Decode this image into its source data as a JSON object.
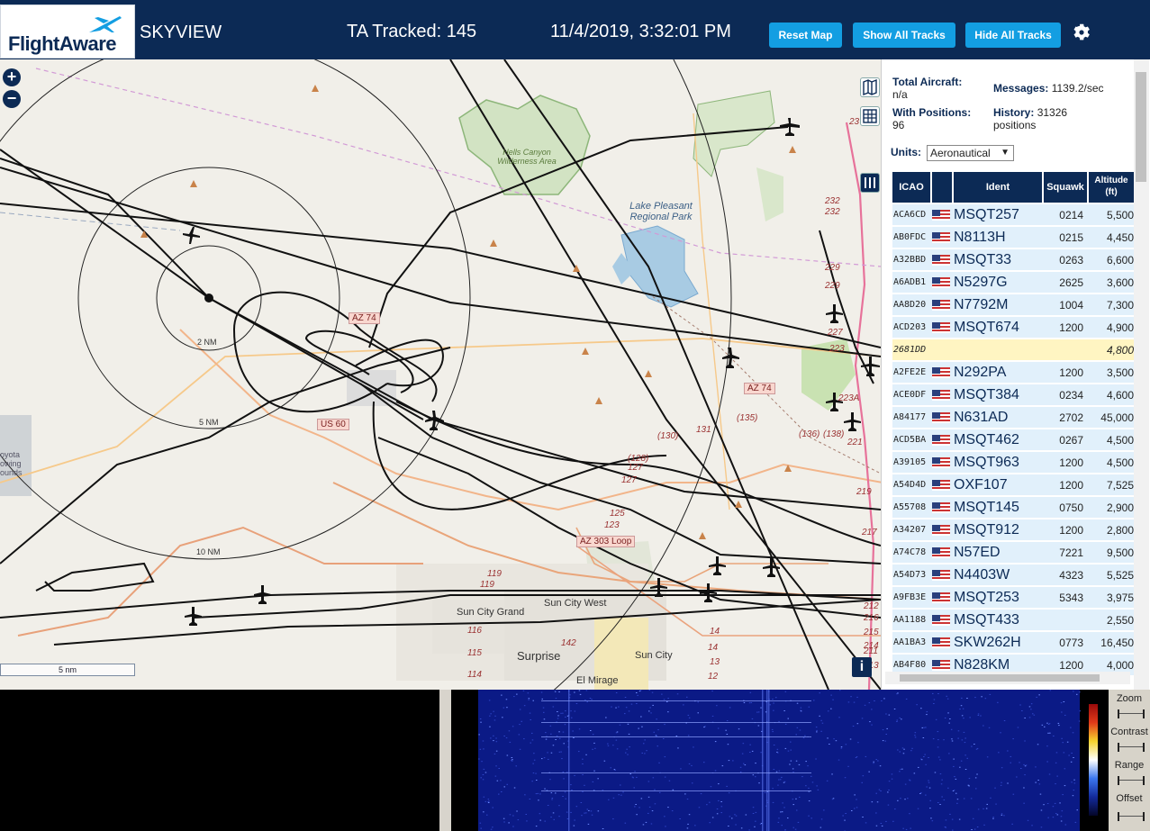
{
  "header": {
    "logo_text": "FlightAware",
    "app_name": "SKYVIEW",
    "ta_tracked": "TA Tracked: 145",
    "datetime": "11/4/2019, 3:32:01 PM",
    "buttons": {
      "reset_map": "Reset Map",
      "show_all": "Show All Tracks",
      "hide_all": "Hide All Tracks"
    },
    "settings_icon": "gear-icon"
  },
  "map": {
    "zoom_in": "+",
    "zoom_out": "−",
    "range_rings": [
      "2 NM",
      "5 NM",
      "10 NM"
    ],
    "places": {
      "hells_canyon": "Hells Canyon Wilderness Area",
      "lake_pleasant": "Lake Pleasant Regional Park",
      "sun_city_grand": "Sun City Grand",
      "sun_city_west": "Sun City West",
      "surprise": "Surprise",
      "sun_city": "Sun City",
      "el_mirage": "El Mirage",
      "coyote": "oyota owing ounds"
    },
    "road_signs": {
      "az74_west": "AZ 74",
      "az74_east": "AZ 74",
      "us60": "US 60",
      "az303": "AZ 303 Loop"
    },
    "route_numbers": [
      "232",
      "232",
      "229",
      "229",
      "227",
      "223",
      "223A",
      "221",
      "219",
      "217",
      "216",
      "215",
      "214",
      "213",
      "212",
      "211",
      "(135)",
      "(136)",
      "(138)",
      "(130)",
      "131",
      "(128)",
      "127",
      "127",
      "125",
      "123",
      "119",
      "119",
      "116",
      "115",
      "114",
      "142",
      "14",
      "14",
      "13",
      "12",
      "23"
    ],
    "scale_label": "5 nm",
    "info_button": "i"
  },
  "sidebar": {
    "total_aircraft_label": "Total Aircraft:",
    "total_aircraft_value": "n/a",
    "with_positions_label": "With Positions:",
    "with_positions_value": "96",
    "messages_label": "Messages:",
    "messages_value": "1139.2/sec",
    "history_label": "History:",
    "history_value": "31326",
    "history_unit": "positions",
    "units_label": "Units:",
    "units_value": "Aeronautical",
    "columns": [
      "ICAO",
      "",
      "Ident",
      "Squawk",
      "Altitude (ft)"
    ],
    "rows": [
      {
        "icao": "ACA6CD",
        "ident": "MSQT257",
        "squawk": "0214",
        "alt": "5,500"
      },
      {
        "icao": "AB0FDC",
        "ident": "N8113H",
        "squawk": "0215",
        "alt": "4,450"
      },
      {
        "icao": "A32BBD",
        "ident": "MSQT33",
        "squawk": "0263",
        "alt": "6,600"
      },
      {
        "icao": "A6ADB1",
        "ident": "N5297G",
        "squawk": "2625",
        "alt": "3,600"
      },
      {
        "icao": "AA8D20",
        "ident": "N7792M",
        "squawk": "1004",
        "alt": "7,300"
      },
      {
        "icao": "ACD203",
        "ident": "MSQT674",
        "squawk": "1200",
        "alt": "4,900"
      },
      {
        "icao": "2681DD",
        "ident": "",
        "squawk": "",
        "alt": "4,800",
        "selected": true
      },
      {
        "icao": "A2FE2E",
        "ident": "N292PA",
        "squawk": "1200",
        "alt": "3,500"
      },
      {
        "icao": "ACE0DF",
        "ident": "MSQT384",
        "squawk": "0234",
        "alt": "4,600"
      },
      {
        "icao": "A84177",
        "ident": "N631AD",
        "squawk": "2702",
        "alt": "45,000"
      },
      {
        "icao": "ACD5BA",
        "ident": "MSQT462",
        "squawk": "0267",
        "alt": "4,500"
      },
      {
        "icao": "A39105",
        "ident": "MSQT963",
        "squawk": "1200",
        "alt": "4,500"
      },
      {
        "icao": "A54D4D",
        "ident": "OXF107",
        "squawk": "1200",
        "alt": "7,525"
      },
      {
        "icao": "A55708",
        "ident": "MSQT145",
        "squawk": "0750",
        "alt": "2,900"
      },
      {
        "icao": "A34207",
        "ident": "MSQT912",
        "squawk": "1200",
        "alt": "2,800"
      },
      {
        "icao": "A74C78",
        "ident": "N57ED",
        "squawk": "7221",
        "alt": "9,500"
      },
      {
        "icao": "A54D73",
        "ident": "N4403W",
        "squawk": "4323",
        "alt": "5,525"
      },
      {
        "icao": "A9FB3E",
        "ident": "MSQT253",
        "squawk": "5343",
        "alt": "3,975"
      },
      {
        "icao": "AA1188",
        "ident": "MSQT433",
        "squawk": "",
        "alt": "2,550"
      },
      {
        "icao": "AA1BA3",
        "ident": "SKW262H",
        "squawk": "0773",
        "alt": "16,450"
      },
      {
        "icao": "AB4F80",
        "ident": "N828KM",
        "squawk": "1200",
        "alt": "4,000"
      }
    ]
  },
  "waterfall": {
    "controls": [
      "Zoom",
      "Contrast",
      "Range",
      "Offset"
    ]
  },
  "colors": {
    "header_bg": "#0c2a55",
    "button": "#139ee2",
    "row": "#e1f0fb",
    "row_selected": "#fff5c2"
  }
}
